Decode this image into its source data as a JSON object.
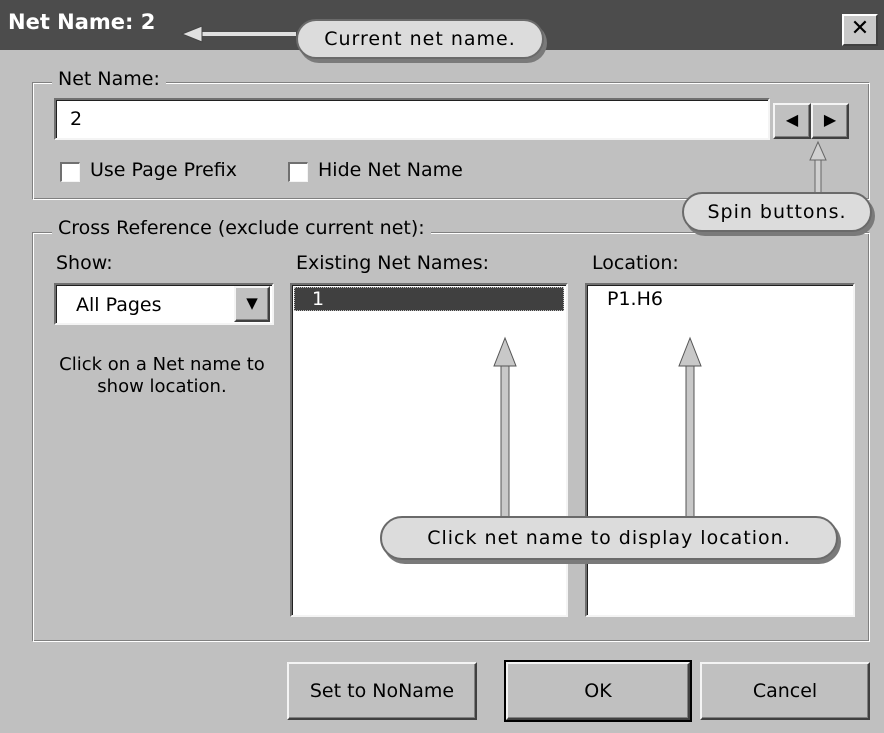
{
  "window": {
    "title": "Net Name: 2",
    "close_glyph": "✕"
  },
  "net_name_group": {
    "legend": "Net Name:",
    "value": "2",
    "spin_left_glyph": "◀",
    "spin_right_glyph": "▶",
    "use_page_prefix_label": "Use Page Prefix",
    "use_page_prefix_checked": false,
    "hide_net_name_label": "Hide Net Name",
    "hide_net_name_checked": false
  },
  "cross_reference": {
    "legend": "Cross Reference (exclude current net):",
    "show_label": "Show:",
    "show_selected": "All Pages",
    "dropdown_glyph": "▼",
    "hint": "Click on a Net name to show location.",
    "existing_label": "Existing Net Names:",
    "existing_items": [
      "1"
    ],
    "selected_existing": "1",
    "location_label": "Location:",
    "location_items": [
      "P1.H6"
    ]
  },
  "buttons": {
    "set_to_noname": "Set to NoName",
    "ok": "OK",
    "cancel": "Cancel"
  },
  "callouts": {
    "current_net_name": "Current net name.",
    "spin_buttons": "Spin buttons.",
    "click_net_name": "Click net name to display location."
  }
}
